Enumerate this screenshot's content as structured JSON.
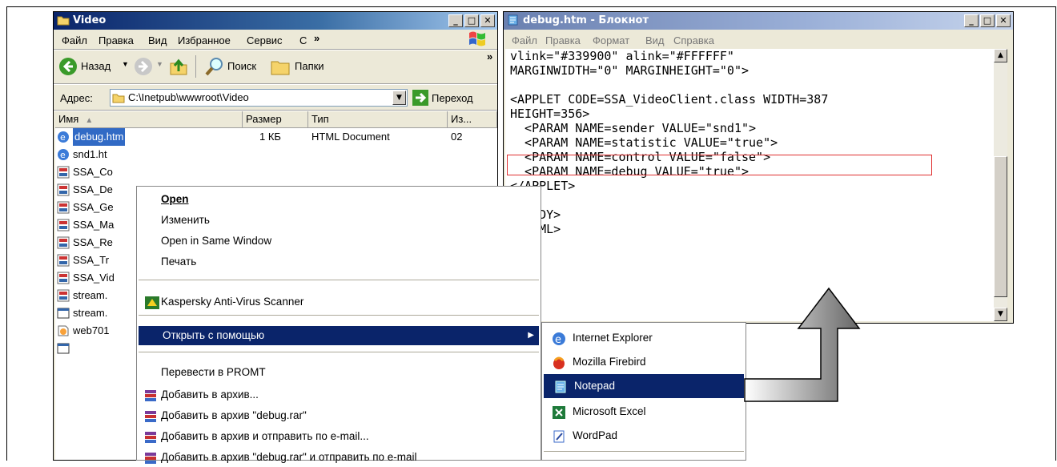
{
  "explorer": {
    "title": "Video",
    "menu": [
      "Файл",
      "Правка",
      "Вид",
      "Избранное",
      "Сервис",
      "С",
      "»"
    ],
    "toolbar": {
      "back": "Назад",
      "search": "Поиск",
      "folders": "Папки",
      "more": "»"
    },
    "address": {
      "label": "Адрес:",
      "value": "C:\\Inetpub\\wwwroot\\Video",
      "go": "Переход"
    },
    "columns": [
      "Имя",
      "Размер",
      "Тип",
      "Из..."
    ],
    "first_row": {
      "name": "debug.htm",
      "size": "1 КБ",
      "type": "HTML Document",
      "modified": "02"
    },
    "files": [
      "snd1.ht",
      "SSA_Co",
      "SSA_De",
      "SSA_Ge",
      "SSA_Ma",
      "SSA_Re",
      "SSA_Tr",
      "SSA_Vid",
      "stream.",
      "stream.",
      "web701"
    ]
  },
  "notepad": {
    "title": "debug.htm - Блокнот",
    "menu": [
      "Файл",
      "Правка",
      "Формат",
      "Вид",
      "Справка"
    ],
    "lines": [
      "vlink=\"#339900\" alink=\"#FFFFFF\"",
      "MARGINWIDTH=\"0\" MARGINHEIGHT=\"0\">",
      "",
      "<APPLET CODE=SSA_VideoClient.class WIDTH=387",
      "HEIGHT=356>",
      "  <PARAM NAME=sender VALUE=\"snd1\">",
      "  <PARAM NAME=statistic VALUE=\"true\">",
      "  <PARAM NAME=control VALUE=\"false\">",
      "  <PARAM NAME=debug VALUE=\"true\">",
      "</APPLET>",
      "",
      "</BODY>",
      "</HTML>"
    ]
  },
  "context_menu": {
    "items": [
      "Open",
      "Изменить",
      "Open in Same Window",
      "Печать",
      "Kaspersky Anti-Virus Scanner",
      "Открыть с помощью",
      "Перевести в PROMT",
      "Добавить в архив...",
      "Добавить в архив \"debug.rar\"",
      "Добавить в архив и отправить по e-mail...",
      "Добавить в архив \"debug.rar\" и отправить по e-mail"
    ]
  },
  "submenu": {
    "items": [
      "Internet Explorer",
      "Mozilla Firebird",
      "Notepad",
      "Microsoft Excel",
      "WordPad"
    ]
  },
  "colors": {
    "titlebar": "#0a246a",
    "highlight": "#0a246a",
    "callout_box": "#e03030"
  }
}
